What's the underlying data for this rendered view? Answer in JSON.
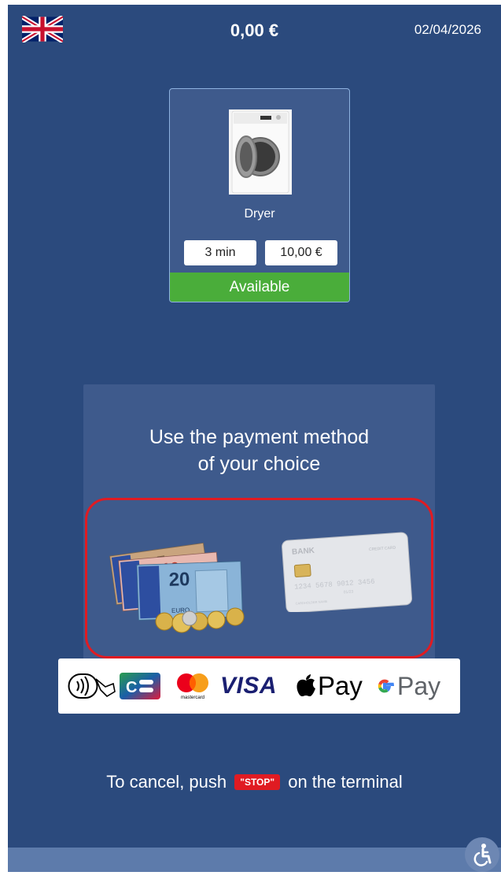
{
  "header": {
    "language_icon": "uk-flag-icon",
    "amount": "0,00 €",
    "date": "02/04/2026"
  },
  "machine": {
    "name": "Dryer",
    "image_icon": "dryer-machine-icon",
    "duration": "3 min",
    "price": "10,00 €",
    "status": "Available",
    "status_color": "#4aad3a"
  },
  "payment": {
    "title": "Use the payment method\nof your choice",
    "highlight_color": "#e01b22",
    "methods": [
      "cash-icon",
      "bank-card-icon"
    ],
    "card_text": {
      "bank": "BANK",
      "type": "CREDIT CARD",
      "number": "1234 5678 9012 3456",
      "expiry": "01/23",
      "holder": "CARDHOLDER NAME"
    },
    "banknote_value": "20",
    "banknote_currency": "EURO",
    "logos": {
      "contactless_icon": "contactless-icon",
      "cb_icon": "cb-logo-icon",
      "mastercard_icon": "mastercard-logo-icon",
      "mastercard_text": "mastercard",
      "visa": "VISA",
      "apple_pay": "Pay",
      "google_pay": "Pay"
    }
  },
  "cancel": {
    "before": "To cancel, push",
    "stop_label": "\"STOP\"",
    "after": "on the terminal"
  },
  "accessibility_icon": "accessibility-icon",
  "colors": {
    "background": "#2b4a7d",
    "panel": "#3e5a8c",
    "accent_red": "#e01b22"
  }
}
